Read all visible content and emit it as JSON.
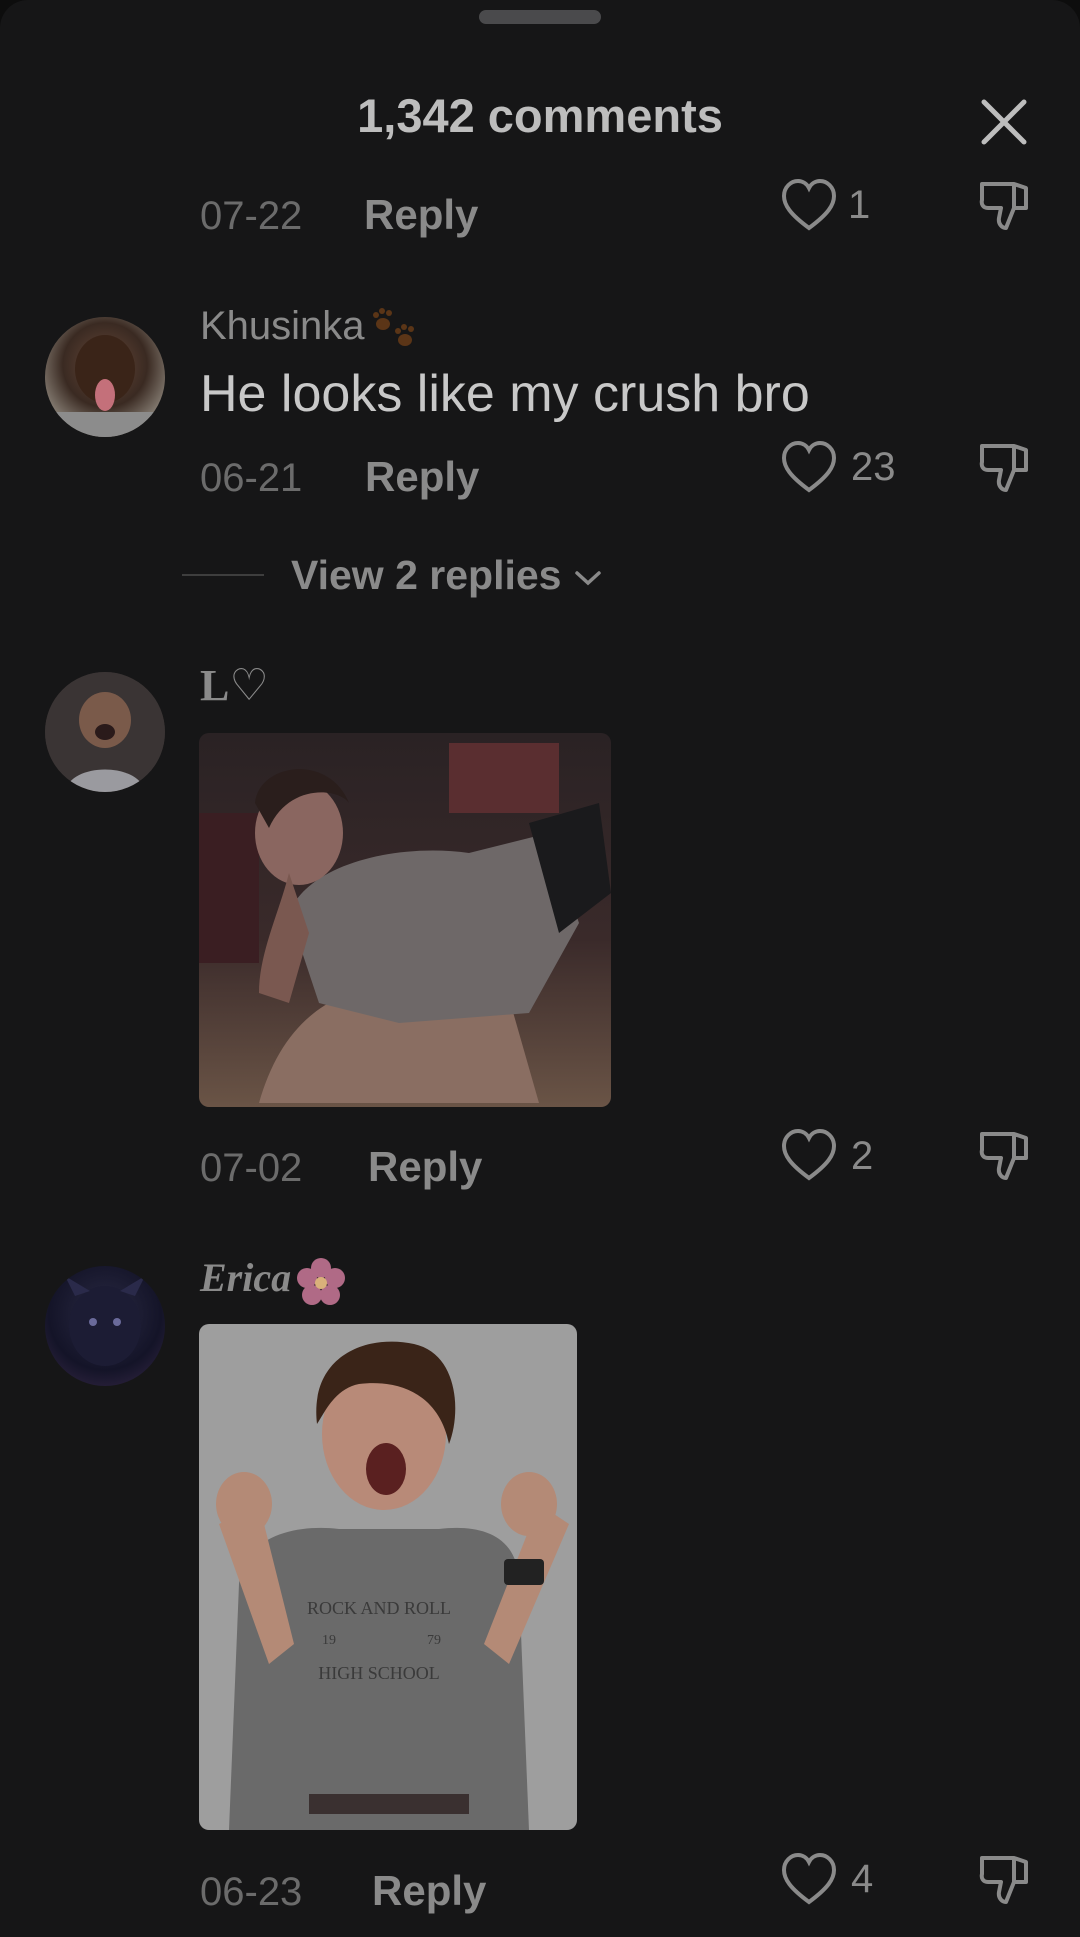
{
  "header": {
    "title": "1,342 comments"
  },
  "comments": [
    {
      "date": "07-22",
      "reply_label": "Reply",
      "likes": "1"
    },
    {
      "username": "Khusinka",
      "text": "He looks like my crush bro",
      "date": "06-21",
      "reply_label": "Reply",
      "likes": "23",
      "view_replies": "View 2 replies"
    },
    {
      "username": "L♡",
      "date": "07-02",
      "reply_label": "Reply",
      "likes": "2"
    },
    {
      "username": "Erica",
      "date": "06-23",
      "reply_label": "Reply",
      "likes": "4"
    }
  ],
  "shirt_print": {
    "top": "ROCK AND ROLL",
    "year_left": "19",
    "year_right": "79",
    "bottom": "HIGH SCHOOL"
  }
}
